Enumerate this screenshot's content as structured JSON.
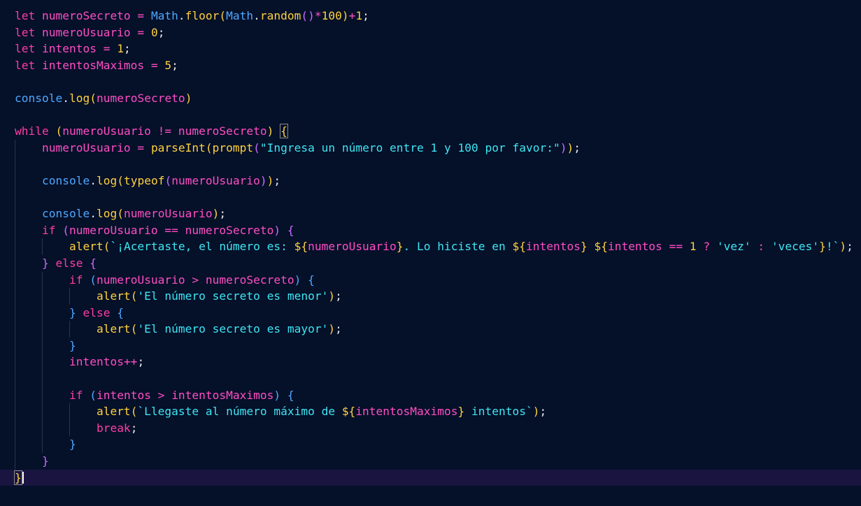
{
  "theme": {
    "background": "#051029",
    "current_line": "#1a1540",
    "colors": {
      "kw": "#ff3ea5",
      "var": "#ff4ec4",
      "fn": "#ffd23f",
      "str": "#3ee6f2",
      "num": "#ffd23f",
      "op": "#ff4ec4",
      "builtin": "#4fa8ff",
      "prop": "#ff7ac8",
      "paren": "#ffd23f",
      "paren2": "#c86bff",
      "brace": "#4fa8ff",
      "brace_y": "#ffd23f",
      "plain": "#e8e8e8",
      "tpl": "#f0f0f0"
    }
  },
  "lines": [
    {
      "indent": 0,
      "tokens": [
        [
          "let ",
          "kw"
        ],
        [
          "numeroSecreto",
          "var"
        ],
        [
          " = ",
          "op"
        ],
        [
          "Math",
          "builtin"
        ],
        [
          ".",
          "plain"
        ],
        [
          "floor",
          "fn"
        ],
        [
          "(",
          "paren"
        ],
        [
          "Math",
          "builtin"
        ],
        [
          ".",
          "plain"
        ],
        [
          "random",
          "fn"
        ],
        [
          "()",
          "paren2"
        ],
        [
          "*",
          "op"
        ],
        [
          "100",
          "num"
        ],
        [
          ")",
          "paren"
        ],
        [
          "+",
          "op"
        ],
        [
          "1",
          "num"
        ],
        [
          ";",
          "plain"
        ]
      ]
    },
    {
      "indent": 0,
      "tokens": [
        [
          "let ",
          "kw"
        ],
        [
          "numeroUsuario",
          "var"
        ],
        [
          " = ",
          "op"
        ],
        [
          "0",
          "num"
        ],
        [
          ";",
          "plain"
        ]
      ]
    },
    {
      "indent": 0,
      "tokens": [
        [
          "let ",
          "kw"
        ],
        [
          "intentos",
          "var"
        ],
        [
          " = ",
          "op"
        ],
        [
          "1",
          "num"
        ],
        [
          ";",
          "plain"
        ]
      ]
    },
    {
      "indent": 0,
      "tokens": [
        [
          "let ",
          "kw"
        ],
        [
          "intentosMaximos",
          "var"
        ],
        [
          " = ",
          "op"
        ],
        [
          "5",
          "num"
        ],
        [
          ";",
          "plain"
        ]
      ]
    },
    {
      "indent": 0,
      "tokens": []
    },
    {
      "indent": 0,
      "tokens": [
        [
          "console",
          "builtin"
        ],
        [
          ".",
          "plain"
        ],
        [
          "log",
          "fn"
        ],
        [
          "(",
          "paren"
        ],
        [
          "numeroSecreto",
          "var"
        ],
        [
          ")",
          "paren"
        ]
      ]
    },
    {
      "indent": 0,
      "tokens": []
    },
    {
      "indent": 0,
      "tokens": [
        [
          "while ",
          "kw"
        ],
        [
          "(",
          "paren"
        ],
        [
          "numeroUsuario",
          "var"
        ],
        [
          " != ",
          "op"
        ],
        [
          "numeroSecreto",
          "var"
        ],
        [
          ")",
          "paren"
        ],
        [
          " ",
          "plain"
        ],
        [
          "{",
          "brace_y"
        ]
      ]
    },
    {
      "indent": 1,
      "tokens": [
        [
          "numeroUsuario",
          "var"
        ],
        [
          " = ",
          "op"
        ],
        [
          "parseInt",
          "fn"
        ],
        [
          "(",
          "paren"
        ],
        [
          "prompt",
          "fn"
        ],
        [
          "(",
          "paren2"
        ],
        [
          "\"Ingresa un número entre 1 y 100 por favor:\"",
          "str"
        ],
        [
          ")",
          "paren2"
        ],
        [
          ")",
          "paren"
        ],
        [
          ";",
          "plain"
        ]
      ]
    },
    {
      "indent": 1,
      "tokens": []
    },
    {
      "indent": 1,
      "tokens": [
        [
          "console",
          "builtin"
        ],
        [
          ".",
          "plain"
        ],
        [
          "log",
          "fn"
        ],
        [
          "(",
          "paren"
        ],
        [
          "typeof",
          "fn"
        ],
        [
          "(",
          "paren2"
        ],
        [
          "numeroUsuario",
          "var"
        ],
        [
          ")",
          "paren2"
        ],
        [
          ")",
          "paren"
        ],
        [
          ";",
          "plain"
        ]
      ]
    },
    {
      "indent": 1,
      "tokens": []
    },
    {
      "indent": 1,
      "tokens": [
        [
          "console",
          "builtin"
        ],
        [
          ".",
          "plain"
        ],
        [
          "log",
          "fn"
        ],
        [
          "(",
          "paren"
        ],
        [
          "numeroUsuario",
          "var"
        ],
        [
          ")",
          "paren"
        ],
        [
          ";",
          "plain"
        ]
      ]
    },
    {
      "indent": 1,
      "tokens": [
        [
          "if ",
          "kw"
        ],
        [
          "(",
          "paren2"
        ],
        [
          "numeroUsuario",
          "var"
        ],
        [
          " == ",
          "op"
        ],
        [
          "numeroSecreto",
          "var"
        ],
        [
          ")",
          "paren2"
        ],
        [
          " ",
          "plain"
        ],
        [
          "{",
          "paren2"
        ]
      ]
    },
    {
      "indent": 2,
      "tokens": [
        [
          "alert",
          "fn"
        ],
        [
          "(",
          "paren"
        ],
        [
          "`¡Acertaste, el número es: ",
          "str"
        ],
        [
          "${",
          "fn"
        ],
        [
          "numeroUsuario",
          "var"
        ],
        [
          "}",
          "fn"
        ],
        [
          ". Lo hiciste en ",
          "str"
        ],
        [
          "${",
          "fn"
        ],
        [
          "intentos",
          "var"
        ],
        [
          "}",
          "fn"
        ],
        [
          " ",
          "str"
        ],
        [
          "${",
          "fn"
        ],
        [
          "intentos",
          "var"
        ],
        [
          " == ",
          "op"
        ],
        [
          "1",
          "num"
        ],
        [
          " ? ",
          "op"
        ],
        [
          "'vez'",
          "str"
        ],
        [
          " : ",
          "op"
        ],
        [
          "'veces'",
          "str"
        ],
        [
          "}",
          "fn"
        ],
        [
          "!`",
          "str"
        ],
        [
          ")",
          "paren"
        ],
        [
          ";",
          "plain"
        ]
      ]
    },
    {
      "indent": 1,
      "tokens": [
        [
          "}",
          "paren2"
        ],
        [
          " else ",
          "kw"
        ],
        [
          "{",
          "paren2"
        ]
      ]
    },
    {
      "indent": 2,
      "tokens": [
        [
          "if ",
          "kw"
        ],
        [
          "(",
          "brace"
        ],
        [
          "numeroUsuario",
          "var"
        ],
        [
          " > ",
          "op"
        ],
        [
          "numeroSecreto",
          "var"
        ],
        [
          ")",
          "brace"
        ],
        [
          " ",
          "plain"
        ],
        [
          "{",
          "brace"
        ]
      ]
    },
    {
      "indent": 3,
      "tokens": [
        [
          "alert",
          "fn"
        ],
        [
          "(",
          "paren"
        ],
        [
          "'El número secreto es menor'",
          "str"
        ],
        [
          ")",
          "paren"
        ],
        [
          ";",
          "plain"
        ]
      ]
    },
    {
      "indent": 2,
      "tokens": [
        [
          "}",
          "brace"
        ],
        [
          " else ",
          "kw"
        ],
        [
          "{",
          "brace"
        ]
      ]
    },
    {
      "indent": 3,
      "tokens": [
        [
          "alert",
          "fn"
        ],
        [
          "(",
          "paren"
        ],
        [
          "'El número secreto es mayor'",
          "str"
        ],
        [
          ")",
          "paren"
        ],
        [
          ";",
          "plain"
        ]
      ]
    },
    {
      "indent": 2,
      "tokens": [
        [
          "}",
          "brace"
        ]
      ]
    },
    {
      "indent": 2,
      "tokens": [
        [
          "intentos",
          "var"
        ],
        [
          "++",
          "op"
        ],
        [
          ";",
          "plain"
        ]
      ]
    },
    {
      "indent": 2,
      "tokens": []
    },
    {
      "indent": 2,
      "tokens": [
        [
          "if ",
          "kw"
        ],
        [
          "(",
          "brace"
        ],
        [
          "intentos",
          "var"
        ],
        [
          " > ",
          "op"
        ],
        [
          "intentosMaximos",
          "var"
        ],
        [
          ")",
          "brace"
        ],
        [
          " ",
          "plain"
        ],
        [
          "{",
          "brace"
        ]
      ]
    },
    {
      "indent": 3,
      "tokens": [
        [
          "alert",
          "fn"
        ],
        [
          "(",
          "paren"
        ],
        [
          "`Llegaste al número máximo de ",
          "str"
        ],
        [
          "${",
          "fn"
        ],
        [
          "intentosMaximos",
          "var"
        ],
        [
          "}",
          "fn"
        ],
        [
          " intentos`",
          "str"
        ],
        [
          ")",
          "paren"
        ],
        [
          ";",
          "plain"
        ]
      ]
    },
    {
      "indent": 3,
      "tokens": [
        [
          "break",
          "kw"
        ],
        [
          ";",
          "plain"
        ]
      ]
    },
    {
      "indent": 2,
      "tokens": [
        [
          "}",
          "brace"
        ]
      ]
    },
    {
      "indent": 1,
      "tokens": [
        [
          "}",
          "paren2"
        ]
      ]
    },
    {
      "indent": 0,
      "tokens": [
        [
          "}",
          "brace_y"
        ]
      ]
    }
  ],
  "current_line_index": 28,
  "bracket_match_indices": [
    [
      7,
      7
    ],
    [
      28,
      0
    ]
  ]
}
